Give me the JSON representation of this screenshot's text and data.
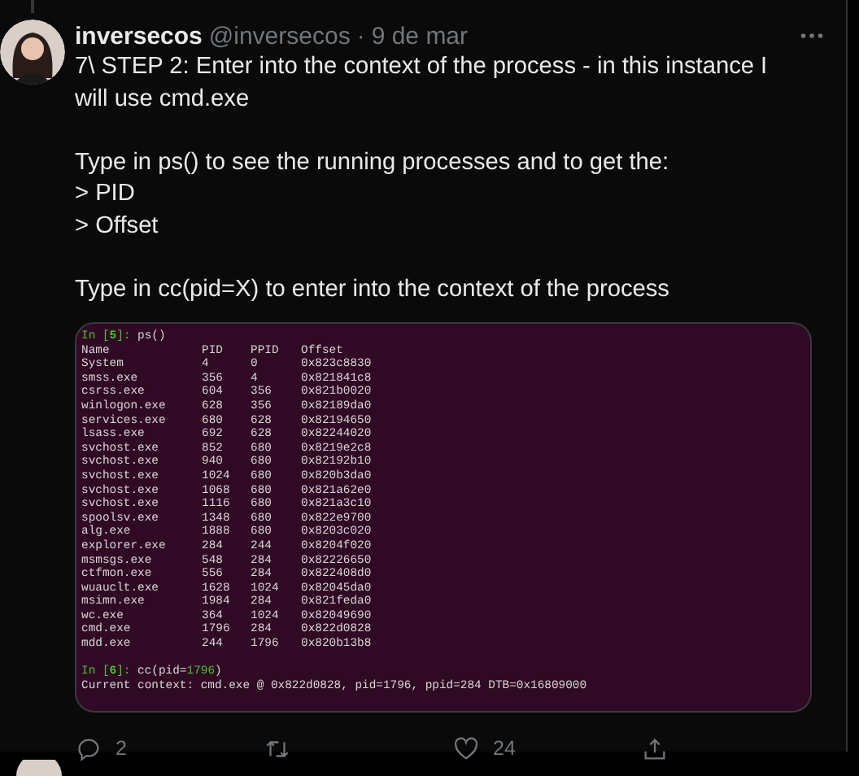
{
  "tweet": {
    "author": "inversecos",
    "handle": "@inversecos",
    "separator": "·",
    "date": "9 de mar",
    "paragraphs": [
      [
        "7\\ STEP 2: Enter into the context of the process - in this instance I will use cmd.exe"
      ],
      [
        "Type in ps() to see the running processes and to get the:",
        "> PID",
        "> Offset"
      ],
      [
        "Type in cc(pid=X) to enter into the context of the process"
      ]
    ]
  },
  "terminal": {
    "lines": [
      {
        "kind": "prompt",
        "label": "In [",
        "number": "5",
        "close": "]:",
        "command": "ps()"
      },
      {
        "kind": "table",
        "columns": [
          "Name",
          "PID",
          "PPID",
          "Offset"
        ],
        "rows": [
          [
            "System",
            "4",
            "0",
            "0x823c8830"
          ],
          [
            "smss.exe",
            "356",
            "4",
            "0x821841c8"
          ],
          [
            "csrss.exe",
            "604",
            "356",
            "0x821b0020"
          ],
          [
            "winlogon.exe",
            "628",
            "356",
            "0x82189da0"
          ],
          [
            "services.exe",
            "680",
            "628",
            "0x82194650"
          ],
          [
            "lsass.exe",
            "692",
            "628",
            "0x82244020"
          ],
          [
            "svchost.exe",
            "852",
            "680",
            "0x8219e2c8"
          ],
          [
            "svchost.exe",
            "940",
            "680",
            "0x82192b10"
          ],
          [
            "svchost.exe",
            "1024",
            "680",
            "0x820b3da0"
          ],
          [
            "svchost.exe",
            "1068",
            "680",
            "0x821a62e0"
          ],
          [
            "svchost.exe",
            "1116",
            "680",
            "0x821a3c10"
          ],
          [
            "spoolsv.exe",
            "1348",
            "680",
            "0x822e9700"
          ],
          [
            "alg.exe",
            "1888",
            "680",
            "0x8203c020"
          ],
          [
            "explorer.exe",
            "284",
            "244",
            "0x8204f020"
          ],
          [
            "msmsgs.exe",
            "548",
            "284",
            "0x82226650"
          ],
          [
            "ctfmon.exe",
            "556",
            "284",
            "0x822408d0"
          ],
          [
            "wuauclt.exe",
            "1628",
            "1024",
            "0x82045da0"
          ],
          [
            "msimn.exe",
            "1984",
            "284",
            "0x821feda0"
          ],
          [
            "wc.exe",
            "364",
            "1024",
            "0x82049690"
          ],
          [
            "cmd.exe",
            "1796",
            "284",
            "0x822d0828"
          ],
          [
            "mdd.exe",
            "244",
            "1796",
            "0x820b13b8"
          ]
        ]
      },
      {
        "kind": "blank"
      },
      {
        "kind": "prompt",
        "label": "In [",
        "number": "6",
        "close": "]:",
        "command": "cc(pid=",
        "arg": "1796",
        "end": ")"
      },
      {
        "kind": "output",
        "text": "Current context: cmd.exe @ 0x822d0828, pid=1796, ppid=284 DTB=0x16809000"
      }
    ]
  },
  "actions": [
    {
      "kind": "reply",
      "count": "2"
    },
    {
      "kind": "retweet"
    },
    {
      "kind": "like",
      "count": "24"
    },
    {
      "kind": "share"
    }
  ]
}
